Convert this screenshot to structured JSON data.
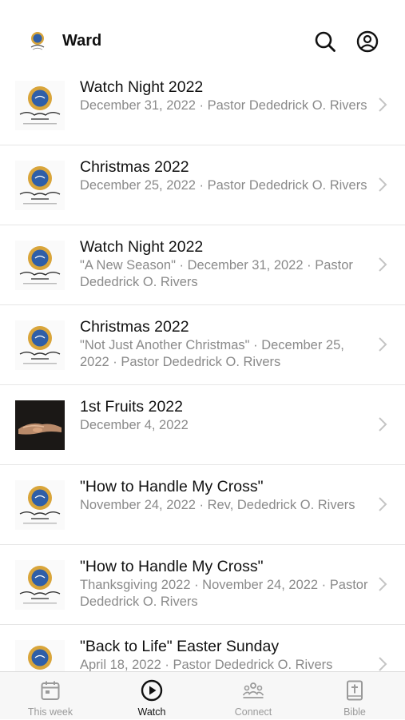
{
  "header": {
    "title": "Ward"
  },
  "items": [
    {
      "title": "Watch Night 2022",
      "subtitle": "December 31, 2022 · Pastor Dededrick O. Rivers",
      "thumb": "church-logo"
    },
    {
      "title": "Christmas 2022",
      "subtitle": "December 25, 2022 · Pastor Dededrick O. Rivers",
      "thumb": "church-logo"
    },
    {
      "title": "Watch Night 2022",
      "subtitle": "\"A New Season\" · December 31, 2022 · Pastor Dededrick O. Rivers",
      "thumb": "church-logo"
    },
    {
      "title": "Christmas 2022",
      "subtitle": "\"Not Just Another Christmas\" · December 25, 2022 · Pastor Dededrick O. Rivers",
      "thumb": "church-logo"
    },
    {
      "title": "1st Fruits 2022",
      "subtitle": "December 4, 2022",
      "thumb": "hands-photo"
    },
    {
      "title": "\"How to Handle My Cross\"",
      "subtitle": "November 24, 2022 · Rev, Dededrick O. Rivers",
      "thumb": "church-logo"
    },
    {
      "title": "\"How to Handle My Cross\"",
      "subtitle": "Thanksgiving 2022 · November 24, 2022 · Pastor Dededrick O. Rivers",
      "thumb": "church-logo"
    },
    {
      "title": "\"Back to Life\"  Easter Sunday",
      "subtitle": "April 18, 2022 · Pastor Dededrick O. Rivers",
      "thumb": "church-logo"
    }
  ],
  "tabs": [
    {
      "label": "This week",
      "icon": "calendar-icon"
    },
    {
      "label": "Watch",
      "icon": "play-circle-icon",
      "active": true
    },
    {
      "label": "Connect",
      "icon": "people-icon"
    },
    {
      "label": "Bible",
      "icon": "bible-icon"
    }
  ]
}
